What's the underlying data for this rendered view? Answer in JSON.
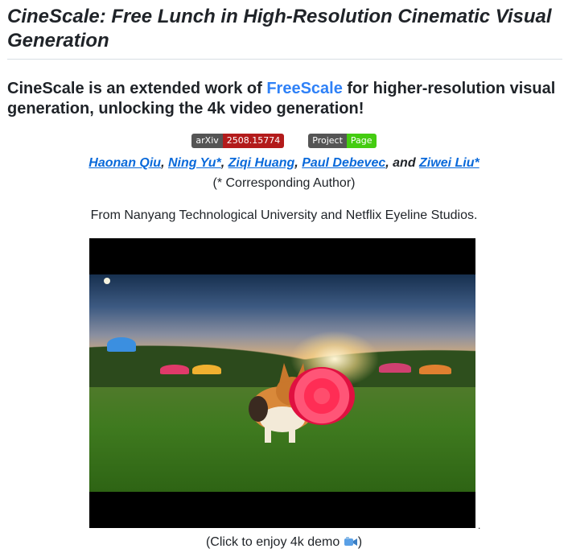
{
  "title": "CineScale: Free Lunch in High-Resolution Cinematic Visual Generation",
  "subtitle": {
    "before": "CineScale is an extended work of ",
    "link": "FreeScale",
    "after": " for higher-resolution visual generation, unlocking the 4k video generation!"
  },
  "badges": {
    "arxiv_left": "arXiv",
    "arxiv_right": "2508.15774",
    "project_left": "Project",
    "project_right": "Page"
  },
  "authors": [
    {
      "name": "Haonan Qiu",
      "sep": ", "
    },
    {
      "name": "Ning Yu*",
      "sep": ", "
    },
    {
      "name": "Ziqi Huang",
      "sep": ", "
    },
    {
      "name": "Paul Debevec",
      "sep": ", and "
    },
    {
      "name": "Ziwei Liu*",
      "sep": ""
    }
  ],
  "corresponding": "(* Corresponding Author)",
  "affiliation": "From Nanyang Technological University and Netflix Eyeline Studios.",
  "trailing_dot": ".",
  "caption": {
    "before": "(Click to enjoy 4k demo ",
    "icon": "video-camera-icon",
    "after": ")"
  },
  "colors": {
    "link_blue": "#2f81f7",
    "author_link": "#0969da",
    "arxiv_red": "#b31b1b",
    "project_green": "#44cc11",
    "badge_gray": "#555555"
  }
}
